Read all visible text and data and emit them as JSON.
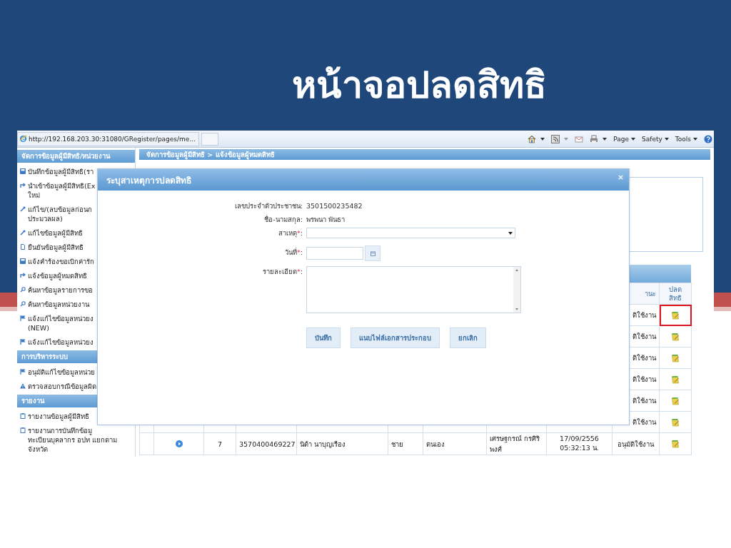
{
  "slide": {
    "title": "หน้าจอปลดสิทธิ"
  },
  "browser": {
    "address": "http://192.168.203.30:31080/GRegister/pages/me...",
    "commands": [
      "Page",
      "Safety",
      "Tools"
    ]
  },
  "sidebar": {
    "groups": [
      {
        "title": "จัดการข้อมูลผู้มีสิทธิ/หน่วยงาน",
        "items": [
          {
            "kind": "save",
            "lines": [
              "บันทึกข้อมูลผู้มีสิทธิ(รา"
            ]
          },
          {
            "kind": "import",
            "lines": [
              "นำเข้าข้อมูลผู้มีสิทธิ(Ex",
              "ใหม่"
            ]
          },
          {
            "kind": "edit",
            "lines": [
              "แก้ไข/(ลบข้อมูลก่อนก",
              "ประมวลผล)"
            ]
          },
          {
            "kind": "edit",
            "lines": [
              "แก้ไขข้อมูลผู้มีสิทธิ"
            ]
          },
          {
            "kind": "page",
            "lines": [
              "ยืนยันข้อมูลผู้มีสิทธิ"
            ]
          },
          {
            "kind": "save",
            "lines": [
              "แจ้งคำร้องขอเบิกค่ารัก"
            ]
          },
          {
            "kind": "import",
            "lines": [
              "แจ้งข้อมูลผู้หมดสิทธิ"
            ]
          },
          {
            "kind": "search",
            "lines": [
              "ค้นหาข้อมูลรายการขอ"
            ]
          },
          {
            "kind": "search",
            "lines": [
              "ค้นหาข้อมูลหน่วยงาน"
            ]
          },
          {
            "kind": "flag",
            "lines": [
              "แจ้งแก้ไขข้อมูลหน่วยง",
              "(NEW)"
            ]
          },
          {
            "kind": "flag",
            "lines": [
              "แจ้งแก้ไขข้อมูลหน่วยง"
            ]
          }
        ]
      },
      {
        "title": "การบริหารระบบ",
        "items": [
          {
            "kind": "flag",
            "lines": [
              "อนุมัติแก้ไขข้อมูลหน่วย"
            ]
          },
          {
            "kind": "warning",
            "lines": [
              "ตรวจสอบกรณีข้อมูลผิด"
            ]
          }
        ]
      },
      {
        "title": "รายงาน",
        "items": [
          {
            "kind": "report",
            "lines": [
              "รายงานข้อมูลผู้มีสิทธิ"
            ]
          },
          {
            "kind": "report",
            "lines": [
              "รายงานการบันทึกข้อมู",
              "ทะเบียนบุคลากร อปท แยกตาม",
              "จังหวัด"
            ]
          }
        ]
      }
    ]
  },
  "breadcrumb": "จัดการข้อมูลผู้มีสิทธิ > แจ้งข้อมูลผู้หมดสิทธิ",
  "table": {
    "headers": [
      "านะ",
      "ปลดสิทธิ"
    ],
    "rows": [
      {
        "kind": "covered",
        "cells": [
          "ติใช้งาน"
        ],
        "highlighted": true
      },
      {
        "kind": "covered",
        "cells": [
          "ติใช้งาน"
        ],
        "highlighted": false
      },
      {
        "kind": "covered",
        "cells": [
          "ติใช้งาน"
        ],
        "highlighted": false
      },
      {
        "kind": "covered",
        "cells": [
          "ติใช้งาน"
        ],
        "highlighted": false
      },
      {
        "kind": "covered",
        "cells": [
          "ติใช้งาน"
        ],
        "highlighted": false
      },
      {
        "kind": "covered",
        "cells": [
          "ติใช้งาน"
        ],
        "highlighted": false
      },
      {
        "kind": "full",
        "cells": [
          "7",
          "3570400469227",
          "นิด้า นาบุญเรือง",
          "ชาย",
          "ตนเอง",
          "เศรษฐกรณ์ กรศิริพงศ์",
          "17/09/2556 05:32:13 น.",
          "อนุมัติใช้งาน"
        ],
        "highlighted": false
      }
    ]
  },
  "dialog": {
    "title": "ระบุสาเหตุการปลดสิทธิ",
    "info": [
      {
        "label": "เลขประจำตัวประชาชน:",
        "value": "3501500235482"
      },
      {
        "label": "ชื่อ-นามสกุล:",
        "value": "พรพนา พันธา"
      }
    ],
    "fields": [
      {
        "kind": "select",
        "label": "สาเหตุ",
        "required_mark": "*",
        "suffix": ":"
      },
      {
        "kind": "date",
        "label": "วันที่",
        "required_mark": "*",
        "suffix": ":"
      },
      {
        "kind": "textarea",
        "label": "รายละเอียด",
        "required_mark": "*",
        "suffix": ":"
      }
    ],
    "buttons": [
      "บันทึก",
      "แนบไฟล์เอกสารประกอบ",
      "ยกเลิก"
    ]
  }
}
